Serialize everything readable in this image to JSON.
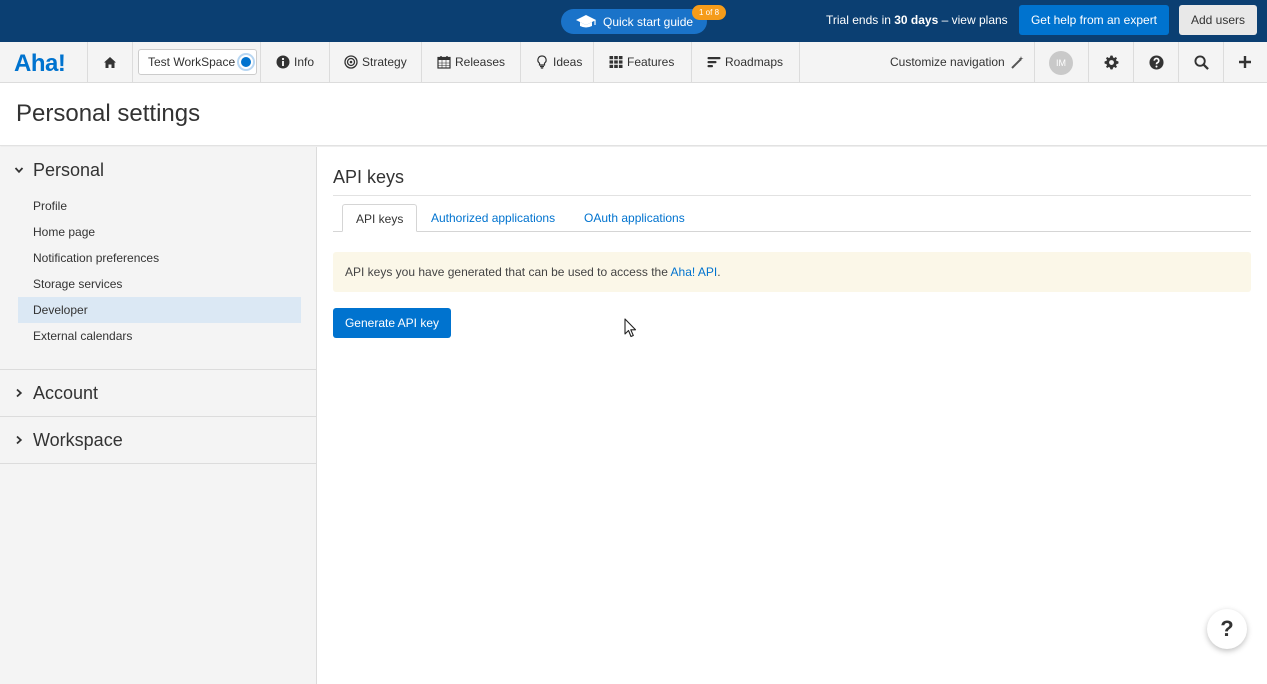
{
  "topbar": {
    "quick_start_label": "Quick start guide",
    "quick_start_badge": "1 of 8",
    "trial_prefix": "Trial ends in ",
    "trial_days": "30 days",
    "trial_suffix": " – view plans",
    "get_help_label": "Get help from an expert",
    "add_users_label": "Add users",
    "bg_color": "#0b3f72",
    "accent_color": "#0073cf"
  },
  "nav": {
    "logo": "Aha!",
    "workspace": "Test WorkSpace",
    "items": [
      {
        "label": "Info",
        "icon": "info-icon"
      },
      {
        "label": "Strategy",
        "icon": "target-icon"
      },
      {
        "label": "Releases",
        "icon": "calendar-icon"
      },
      {
        "label": "Ideas",
        "icon": "lightbulb-icon"
      },
      {
        "label": "Features",
        "icon": "grid-icon"
      },
      {
        "label": "Roadmaps",
        "icon": "roadmap-icon"
      }
    ],
    "customize_label": "Customize navigation",
    "avatar_initials": "IM"
  },
  "page": {
    "title": "Personal settings"
  },
  "sidebar": {
    "personal_label": "Personal",
    "personal_items": [
      {
        "label": "Profile"
      },
      {
        "label": "Home page"
      },
      {
        "label": "Notification preferences"
      },
      {
        "label": "Storage services"
      },
      {
        "label": "Developer"
      },
      {
        "label": "External calendars"
      }
    ],
    "account_label": "Account",
    "workspace_label": "Workspace"
  },
  "main": {
    "heading": "API keys",
    "tabs": [
      {
        "label": "API keys"
      },
      {
        "label": "Authorized applications"
      },
      {
        "label": "OAuth applications"
      }
    ],
    "info_text": "API keys you have generated that can be used to access the ",
    "info_link": "Aha! API",
    "info_end": ".",
    "generate_button": "Generate API key"
  },
  "help_fab": "?"
}
